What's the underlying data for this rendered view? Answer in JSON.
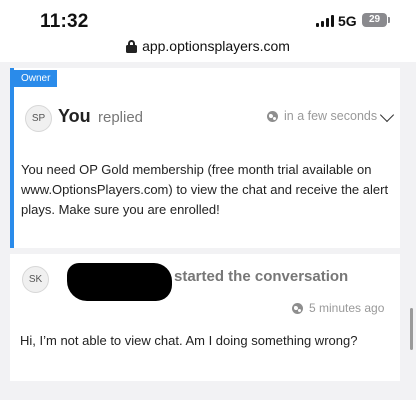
{
  "status_bar": {
    "time": "11:32",
    "network": "5G",
    "battery": "29"
  },
  "browser": {
    "url": "app.optionsplayers.com"
  },
  "reply": {
    "badge": "Owner",
    "avatar_initials": "SP",
    "author": "You",
    "action": "replied",
    "time": "in a few seconds",
    "message": "You need OP Gold membership (free month trial available on www.OptionsPlayers.com) to view the chat and receive the alert plays. Make sure you are enrolled!"
  },
  "conversation_start": {
    "avatar_initials": "SK",
    "action": "started the conversation",
    "time": "5 minutes ago",
    "message": "Hi, I’m not able to view chat. Am I doing something wrong?"
  },
  "colors": {
    "accent": "#2a8bea",
    "muted_text": "#777777"
  },
  "icons": [
    "lock-icon",
    "globe-icon",
    "chevron-down-icon",
    "signal-icon",
    "battery-icon"
  ]
}
